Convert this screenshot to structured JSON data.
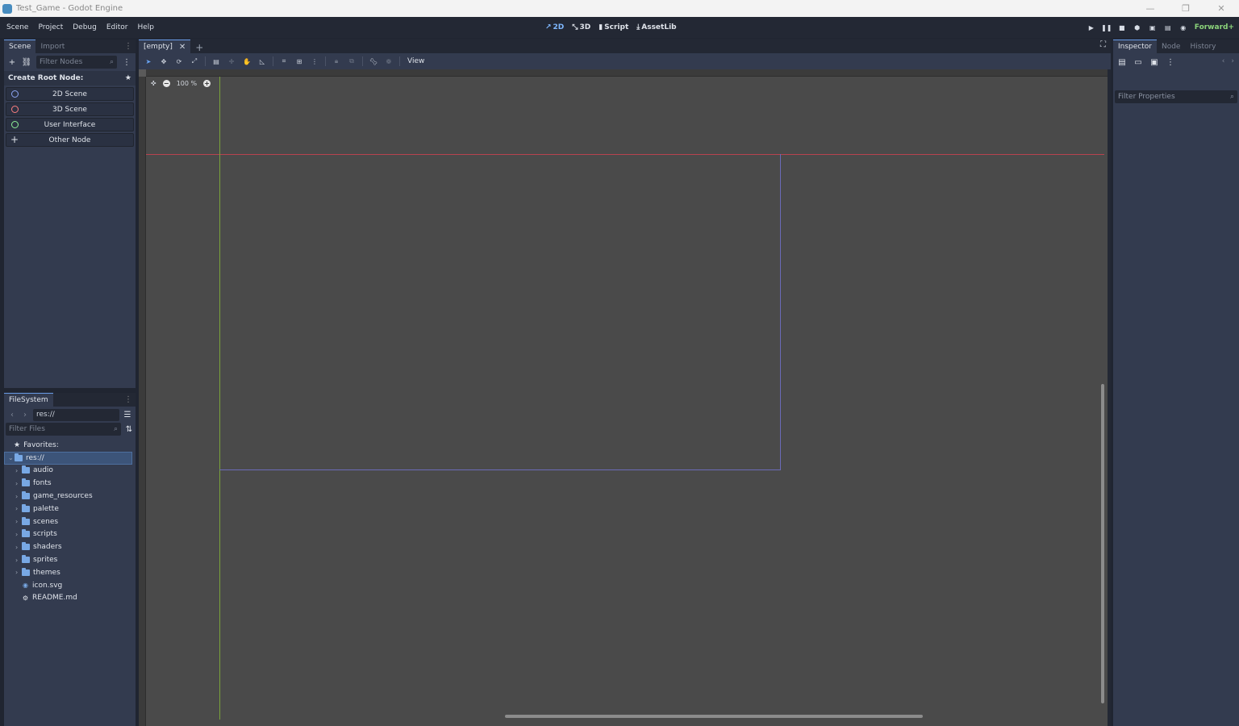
{
  "window": {
    "title": "Test_Game - Godot Engine",
    "controls": [
      "—",
      "❐",
      "✕"
    ]
  },
  "menubar": {
    "menus": [
      "Scene",
      "Project",
      "Debug",
      "Editor",
      "Help"
    ],
    "workspaces": [
      {
        "label": "2D",
        "icon": "2d-icon",
        "active": true
      },
      {
        "label": "3D",
        "icon": "3d-icon",
        "active": false
      },
      {
        "label": "Script",
        "icon": "script-icon",
        "active": false
      },
      {
        "label": "AssetLib",
        "icon": "assetlib-icon",
        "active": false
      }
    ],
    "renderer": "Forward+"
  },
  "scene_dock": {
    "tabs": [
      "Scene",
      "Import"
    ],
    "filter_placeholder": "Filter Nodes",
    "create_root_label": "Create Root Node:",
    "root_buttons": [
      {
        "label": "2D Scene",
        "color": "#8da5f3"
      },
      {
        "label": "3D Scene",
        "color": "#fc7f7f"
      },
      {
        "label": "User Interface",
        "color": "#8eef97"
      },
      {
        "label": "Other Node",
        "color": "#dfe3ea"
      }
    ]
  },
  "filesystem": {
    "tab": "FileSystem",
    "path": "res://",
    "filter_placeholder": "Filter Files",
    "favorites_label": "Favorites:",
    "root": "res://",
    "folders": [
      "audio",
      "fonts",
      "game_resources",
      "palette",
      "scenes",
      "scripts",
      "shaders",
      "sprites",
      "themes"
    ],
    "files": [
      {
        "name": "icon.svg",
        "icon": "image-icon"
      },
      {
        "name": "README.md",
        "icon": "gear-icon"
      }
    ]
  },
  "editor": {
    "scene_tab": "[empty]",
    "view_menu": "View",
    "zoom": "100 %"
  },
  "inspector": {
    "tabs": [
      "Inspector",
      "Node",
      "History"
    ],
    "filter_placeholder": "Filter Properties"
  },
  "colors": {
    "accent": "#699ce8",
    "x_axis": "#b8434f",
    "y_axis": "#7aa23a",
    "frame": "#6b6bb8"
  }
}
